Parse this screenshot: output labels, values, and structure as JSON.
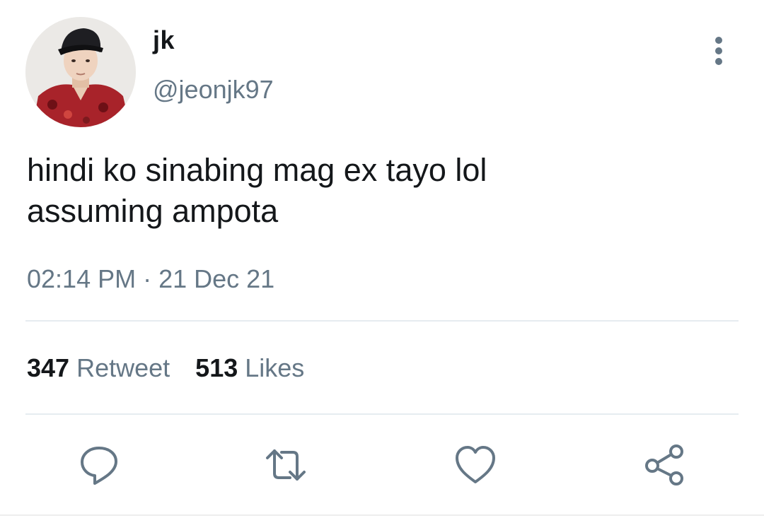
{
  "user": {
    "display_name": "jk",
    "handle": "@jeonjk97"
  },
  "tweet": {
    "text_lines": [
      "hindi ko sinabing mag ex tayo lol",
      "assuming ampota"
    ],
    "timestamp": "02:14 PM · 21 Dec 21"
  },
  "stats": {
    "retweets_count": "347",
    "retweets_label": "Retweet",
    "likes_count": "513",
    "likes_label": "Likes"
  },
  "actions": [
    {
      "name": "reply",
      "icon": "reply-icon"
    },
    {
      "name": "retweet",
      "icon": "retweet-icon"
    },
    {
      "name": "like",
      "icon": "heart-icon"
    },
    {
      "name": "share",
      "icon": "share-icon"
    }
  ],
  "colors": {
    "text": "#14171a",
    "secondary": "#657786",
    "divider": "#e6ecf0"
  }
}
